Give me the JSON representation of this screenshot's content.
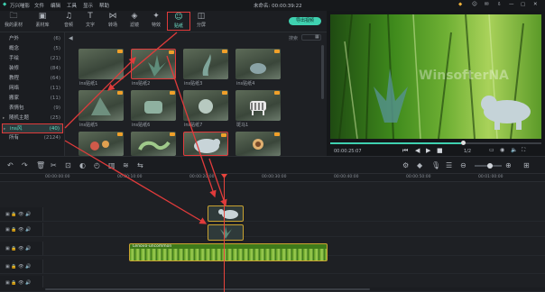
{
  "app": {
    "name": "万兴喵影",
    "menus": [
      "文件",
      "编辑",
      "工具",
      "显示",
      "帮助"
    ],
    "status": "未命名: 00:00:39:22",
    "export_label": "导出视频"
  },
  "toolbar": {
    "items": [
      {
        "label": "我的素材",
        "icon": "folder-icon"
      },
      {
        "label": "素材库",
        "icon": "media-icon"
      },
      {
        "label": "音频",
        "icon": "music-icon"
      },
      {
        "label": "文字",
        "icon": "text-icon"
      },
      {
        "label": "转场",
        "icon": "transition-icon"
      },
      {
        "label": "滤镜",
        "icon": "filter-icon"
      },
      {
        "label": "特效",
        "icon": "effects-icon"
      },
      {
        "label": "贴纸",
        "icon": "sticker-icon"
      },
      {
        "label": "分屏",
        "icon": "split-screen-icon"
      }
    ]
  },
  "sidebar": {
    "items": [
      {
        "name": "户外",
        "count": "(6)",
        "arrow": ""
      },
      {
        "name": "概念",
        "count": "(5)",
        "arrow": ""
      },
      {
        "name": "手绘",
        "count": "(21)",
        "arrow": ""
      },
      {
        "name": "装修",
        "count": "(84)",
        "arrow": ""
      },
      {
        "name": "教程",
        "count": "(64)",
        "arrow": ""
      },
      {
        "name": "网络",
        "count": "(11)",
        "arrow": ""
      },
      {
        "name": "搬家",
        "count": "(11)",
        "arrow": ""
      },
      {
        "name": "表情包",
        "count": "(9)",
        "arrow": ""
      },
      {
        "name": "随机主题",
        "count": "(25)",
        "arrow": "▸"
      },
      {
        "name": "ins风",
        "count": "(40)",
        "arrow": "▸"
      },
      {
        "name": "所有",
        "count": "(2124)",
        "arrow": ""
      }
    ]
  },
  "library": {
    "search_label": "搜索",
    "items": [
      "",
      "ins贴纸1",
      "ins贴纸2",
      "ins贴纸3",
      "ins贴纸4",
      "ins贴纸5",
      "ins贴纸6",
      "ins贴纸7",
      "斑马1",
      "",
      "",
      "",
      ""
    ]
  },
  "preview": {
    "watermark": "WinsofterNA",
    "time": "00:00:25:07",
    "page": "1/2"
  },
  "timeline": {
    "ruler": [
      "00:00:00:00",
      "00:00:10:00",
      "00:00:20:00",
      "00:00:30:00",
      "00:00:40:00",
      "00:00:50:00",
      "00:01:00:00"
    ],
    "clip_label": "Lenovo-uncommon"
  },
  "colors": {
    "accent": "#3fd1b0",
    "highlight": "#e03b3b",
    "playhead": "#e8443c",
    "clip": "#7fb832"
  }
}
